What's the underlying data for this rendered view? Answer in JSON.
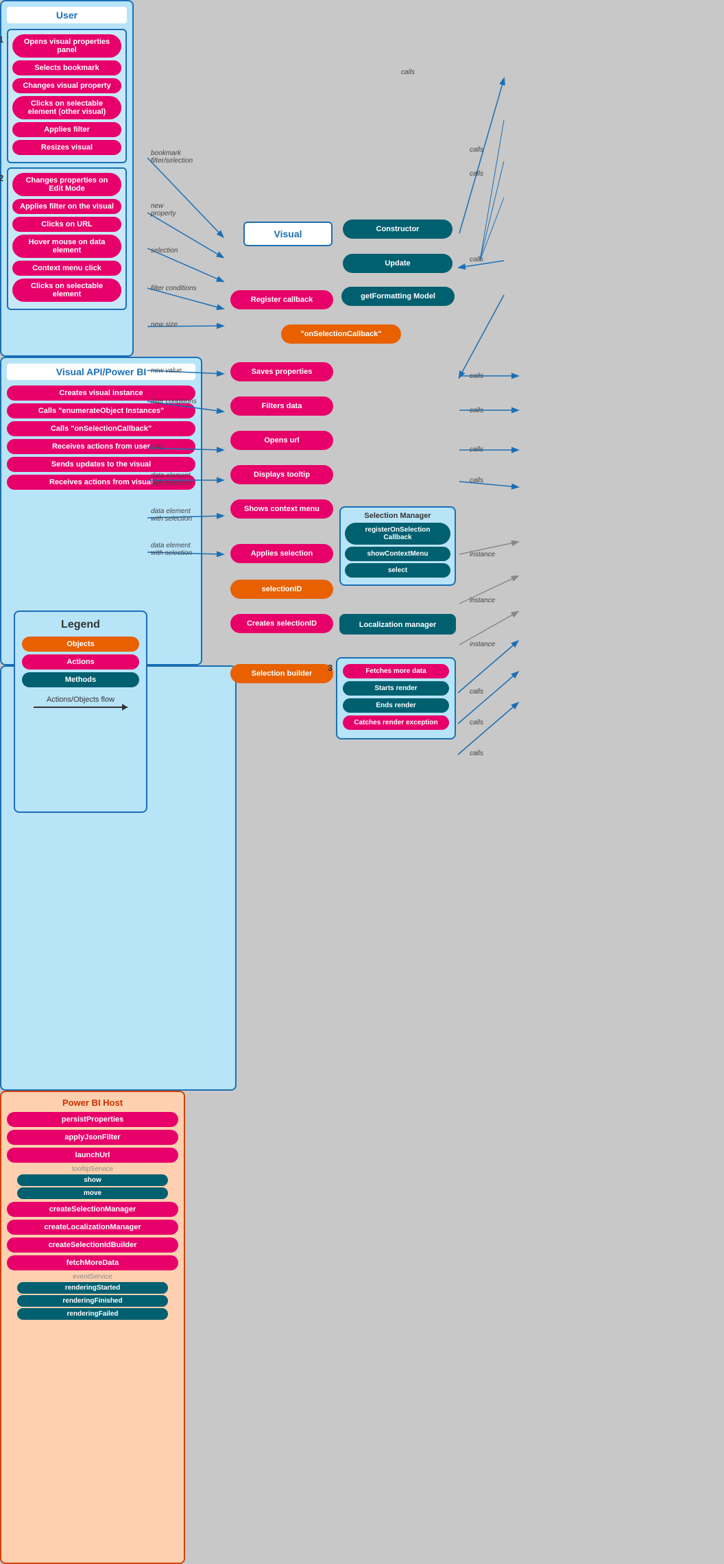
{
  "user": {
    "title": "User",
    "section1_label": "1",
    "section1_items": [
      "Opens visual properties panel",
      "Selects bookmark",
      "Changes visual property",
      "Clicks on selectable element (other visual)",
      "Applies filter",
      "Resizes visual"
    ],
    "section2_label": "2",
    "section2_items": [
      "Changes properties on Edit Mode",
      "Applies filter on the visual",
      "Clicks on URL",
      "Hover mouse on data element",
      "Context menu click",
      "Clicks on selectable element"
    ]
  },
  "visual_api": {
    "title": "Visual API/Power BI",
    "items": [
      "Creates visual instance",
      "Calls \"enumerateObject Instances\"",
      "Calls \"onSelectionCallback\"",
      "Receives actions from user",
      "Sends updates to the visual",
      "Receives actions from visual"
    ]
  },
  "powerbi_host": {
    "title": "Power BI Host",
    "items": [
      "persistProperties",
      "applyJsonFilter",
      "launchUrl"
    ],
    "tooltip": {
      "label": "tooltipService",
      "sub": [
        "show",
        "move"
      ]
    },
    "items2": [
      "createSelectionManager",
      "createLocalizationManager",
      "createSelectionIdBuilder",
      "fetchMoreData"
    ],
    "event": {
      "label": "eventService",
      "sub": [
        "renderingStarted",
        "renderingFinished",
        "renderingFailed"
      ]
    }
  },
  "visual_center": {
    "title": "Visual",
    "items": [
      "Constructor",
      "Update",
      "getFormatting Model",
      "Register callback",
      "\"onSelectionCallback\"",
      "Saves properties",
      "Filters data",
      "Opens url",
      "Displays tooltip",
      "Shows context menu",
      "Applies selection",
      "selectionID",
      "Creates selectionID",
      "Selection builder"
    ]
  },
  "selection_manager": {
    "title": "Selection Manager",
    "items": [
      "registerOnSelection Callback",
      "showContextMenu",
      "select"
    ]
  },
  "localization_manager": {
    "title": "Localization manager"
  },
  "section3": {
    "label": "3",
    "items": [
      "Fetches more data",
      "Starts render",
      "Ends render",
      "Catches render exception"
    ]
  },
  "legend": {
    "title": "Legend",
    "items": [
      {
        "label": "Objects",
        "color": "orange"
      },
      {
        "label": "Actions",
        "color": "pink"
      },
      {
        "label": "Methods",
        "color": "teal"
      }
    ],
    "flow_label": "Actions/Objects flow"
  },
  "flow_labels": {
    "bookmark_filter": "bookmark\nfilter/selection",
    "new_property": "new\nproperty",
    "selection": "selection",
    "filter_conditions1": "filter conditions",
    "new_size": "new size",
    "new_value": "new value",
    "filter_conditions2": "filter conditions",
    "url": "URL",
    "data_element_selection1": "data element\nwith selection",
    "data_element_selection2": "data element\nwith selection",
    "data_element_selection3": "data element\nwith selection",
    "calls": "calls",
    "instance": "instance"
  }
}
